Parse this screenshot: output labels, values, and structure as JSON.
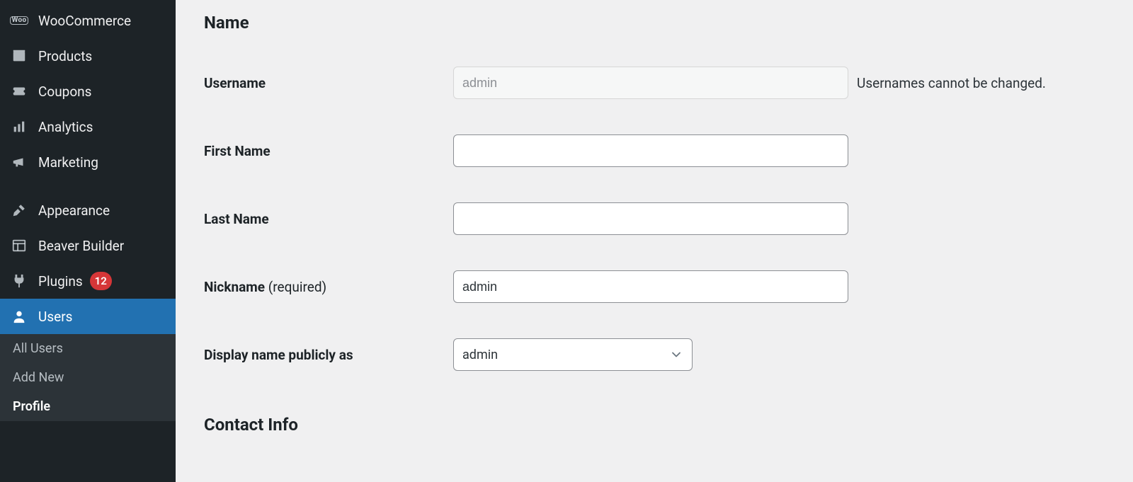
{
  "sidebar": {
    "items": [
      {
        "label": "WooCommerce",
        "icon": "woocommerce-icon"
      },
      {
        "label": "Products",
        "icon": "products-icon"
      },
      {
        "label": "Coupons",
        "icon": "coupons-icon"
      },
      {
        "label": "Analytics",
        "icon": "analytics-icon"
      },
      {
        "label": "Marketing",
        "icon": "marketing-icon"
      },
      {
        "label": "Appearance",
        "icon": "appearance-icon"
      },
      {
        "label": "Beaver Builder",
        "icon": "beaver-builder-icon"
      },
      {
        "label": "Plugins",
        "icon": "plugins-icon",
        "badge": "12"
      },
      {
        "label": "Users",
        "icon": "users-icon",
        "active": true
      }
    ],
    "submenu": [
      {
        "label": "All Users"
      },
      {
        "label": "Add New"
      },
      {
        "label": "Profile",
        "current": true
      }
    ]
  },
  "sections": {
    "name": "Name",
    "contact_info": "Contact Info"
  },
  "fields": {
    "username": {
      "label": "Username",
      "value": "admin",
      "hint": "Usernames cannot be changed."
    },
    "first_name": {
      "label": "First Name",
      "value": ""
    },
    "last_name": {
      "label": "Last Name",
      "value": ""
    },
    "nickname": {
      "label": "Nickname",
      "required_text": "(required)",
      "value": "admin"
    },
    "display_name": {
      "label": "Display name publicly as",
      "selected": "admin"
    }
  }
}
